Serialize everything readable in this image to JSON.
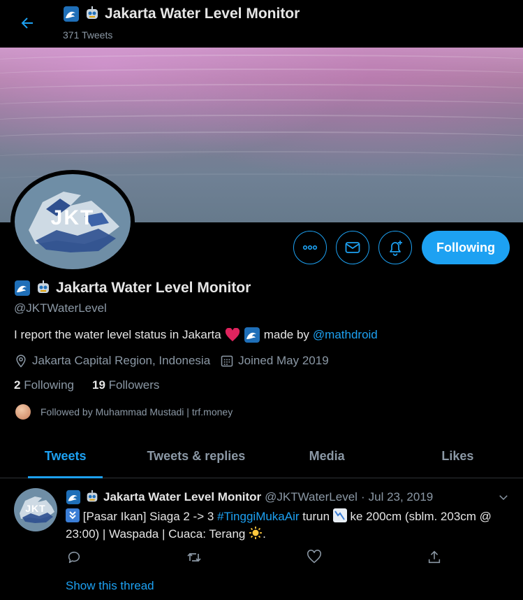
{
  "header": {
    "title": "Jakarta Water Level Monitor",
    "tweet_count": "371 Tweets"
  },
  "profile": {
    "avatar_text": "JKT",
    "name": "Jakarta Water Level Monitor",
    "handle": "@JKTWaterLevel",
    "bio_prefix": "I report the water level status in Jakarta",
    "bio_made_by": "made by",
    "bio_mention": "@mathdroid",
    "location": "Jakarta Capital Region, Indonesia",
    "joined": "Joined May 2019",
    "following_count": "2",
    "following_label": "Following",
    "followers_count": "19",
    "followers_label": "Followers",
    "followed_by": "Followed by Muhammad Mustadi | trf.money"
  },
  "actions": {
    "follow_label": "Following"
  },
  "tabs": [
    {
      "label": "Tweets",
      "active": true
    },
    {
      "label": "Tweets & replies",
      "active": false
    },
    {
      "label": "Media",
      "active": false
    },
    {
      "label": "Likes",
      "active": false
    }
  ],
  "tweet": {
    "avatar_text": "JKT",
    "name": "Jakarta Water Level Monitor",
    "handle": "@JKTWaterLevel",
    "separator": "·",
    "date": "Jul 23, 2019",
    "text_part1": "[Pasar Ikan] Siaga 2 -> 3",
    "hashtag": "#TinggiMukaAir",
    "text_part2": "turun",
    "text_part3": "ke 200cm (sblm. 203cm @ 23:00) | Waspada | Cuaca: Terang",
    "text_end": ".",
    "show_thread": "Show this thread"
  },
  "colors": {
    "accent": "#1da1f2",
    "background": "#000000",
    "muted": "#8b98a5",
    "text": "#e6e6e6",
    "heart": "#e0245e"
  }
}
